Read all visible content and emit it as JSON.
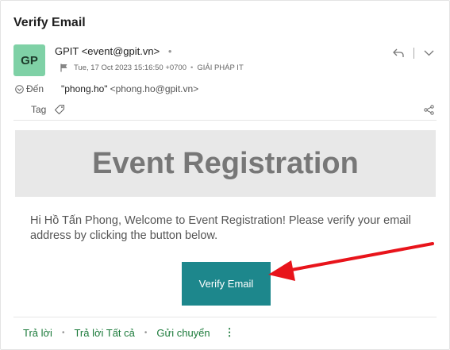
{
  "email": {
    "subject": "Verify Email",
    "avatar_initials": "GP",
    "sender": "GPIT <event@gpit.vn>",
    "sender_dot": "•",
    "date": "Tue, 17 Oct 2023 15:16:50 +0700",
    "meta_sep": "•",
    "folder": "GIẢI PHÁP IT",
    "to_label": "Đến",
    "to_name": "\"phong.ho\"",
    "to_address": "<phong.ho@gpit.vn>",
    "tag_label": "Tag"
  },
  "content": {
    "banner_title": "Event Registration",
    "message": "Hi Hồ Tấn Phong, Welcome to Event Registration! Please verify your email address by clicking the button below.",
    "button_label": "Verify Email"
  },
  "footer": {
    "reply": "Trả lời",
    "reply_all": "Trả lời Tất cả",
    "forward": "Gửi chuyển",
    "dot": "•",
    "more": "⋮"
  },
  "colors": {
    "accent": "#1d878c",
    "avatar": "#7fd1a6",
    "link_green": "#1b7a3a",
    "annotation_arrow": "#e8141b"
  },
  "icons": [
    "flag-icon",
    "reply-icon",
    "chevron-down-icon",
    "expand-circle-icon",
    "tag-icon",
    "share-icon",
    "more-vertical-icon"
  ]
}
